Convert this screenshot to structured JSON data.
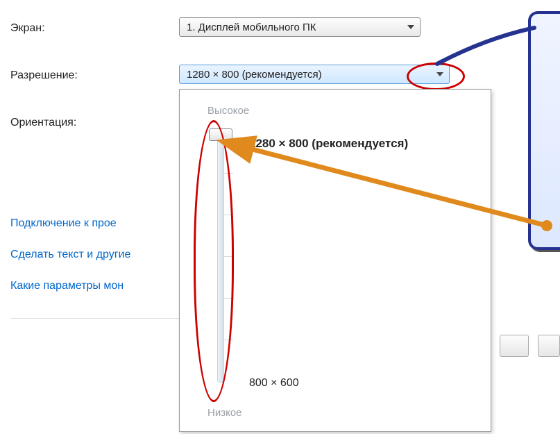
{
  "labels": {
    "screen": "Экран:",
    "resolution": "Разрешение:",
    "orientation": "Ориентация:"
  },
  "screen_dropdown": {
    "selected": "1. Дисплей мобильного ПК"
  },
  "resolution_dropdown": {
    "selected": "1280 × 800 (рекомендуется)"
  },
  "slider": {
    "top_label": "Высокое",
    "bottom_label": "Низкое",
    "max_label": "1280 × 800 (рекомендуется)",
    "min_label": "800 × 600"
  },
  "links": {
    "projector": "Подключение к прое",
    "text_size": "Сделать текст и другие",
    "monitor_params": "Какие параметры мон"
  }
}
